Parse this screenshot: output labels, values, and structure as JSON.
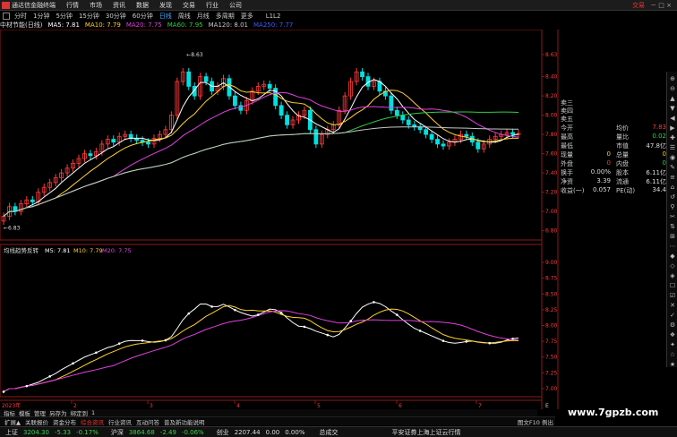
{
  "titlebar": {
    "app_name": "通达信金融终端",
    "menus": [
      "行情",
      "市场",
      "资讯",
      "数据",
      "发现",
      "交易",
      "行业",
      "公司"
    ],
    "trade": "交易",
    "win_controls": "－ □ ×"
  },
  "periods": {
    "items": [
      "分时",
      "1分钟",
      "5分钟",
      "15分钟",
      "30分钟",
      "60分钟",
      "日线",
      "周线",
      "月线",
      "多周期",
      "更多"
    ],
    "active_index": 6,
    "extra": "L1L2"
  },
  "main_legend": {
    "name": "中材节能(日线)",
    "items": [
      {
        "text": "MA5: 7.81",
        "color": "#ffffff"
      },
      {
        "text": "MA10: 7.79",
        "color": "#ffd02b"
      },
      {
        "text": "MA20: 7.75",
        "color": "#e040e0"
      },
      {
        "text": "MA60: 7.95",
        "color": "#30d040"
      },
      {
        "text": "MA120: 8.01",
        "color": "#c8c8c8"
      },
      {
        "text": "MA250: 7.77",
        "color": "#3c5cff"
      }
    ]
  },
  "price_axis": {
    "labels": [
      "8.63",
      "8.40",
      "8.20",
      "8.00",
      "7.80",
      "7.60",
      "7.40",
      "7.20",
      "7.00",
      "6.80"
    ],
    "ticks": [
      8.63,
      8.4,
      8.2,
      8.0,
      7.8,
      7.6,
      7.4,
      7.2,
      7.0,
      6.8
    ],
    "high_label": "8.63",
    "low_label": "6.83"
  },
  "sub_legend": {
    "name": "均线趋势反转",
    "items": [
      {
        "text": "M5: 7.81",
        "color": "#ffffff"
      },
      {
        "text": "M10: 7.79",
        "color": "#ffd02b"
      },
      {
        "text": "M20: 7.75",
        "color": "#e040e0"
      }
    ]
  },
  "sub_axis": {
    "labels": [
      "9.00",
      "8.75",
      "8.50",
      "8.25",
      "8.00",
      "7.75",
      "7.50",
      "7.25",
      "7.00"
    ],
    "ticks": [
      9.0,
      8.75,
      8.5,
      8.25,
      8.0,
      7.75,
      7.5,
      7.25,
      7.0
    ]
  },
  "x_axis": {
    "labels": [
      "2023年",
      "2",
      "3",
      "4",
      "5",
      "6",
      "7"
    ],
    "corner": "E"
  },
  "right_panel": {
    "order_book": [
      "卖三",
      "卖四",
      "卖五"
    ],
    "rows": [
      {
        "l1": "今开",
        "v1": "",
        "l2": "均价",
        "v2": "7.83",
        "c1": "#ddd",
        "c2": "#ff3b3b"
      },
      {
        "l1": "最高",
        "v1": "",
        "l2": "量比",
        "v2": "0.02",
        "c1": "#ff3b3b",
        "c2": "#3bd44b"
      },
      {
        "l1": "最低",
        "v1": "",
        "l2": "市值",
        "v2": "47.8亿",
        "c1": "#3bd44b",
        "c2": "#ddd"
      },
      {
        "l1": "现量",
        "v1": "0",
        "l2": "总量",
        "v2": "0",
        "c1": "#ffd02b",
        "c2": "#ffd02b"
      },
      {
        "l1": "外盘",
        "v1": "0",
        "l2": "内盘",
        "v2": "0",
        "c1": "#ff3b3b",
        "c2": "#3bd44b"
      },
      {
        "l1": "换手",
        "v1": "0.00%",
        "l2": "股本",
        "v2": "6.11亿",
        "c1": "#ddd",
        "c2": "#ddd"
      },
      {
        "l1": "净资",
        "v1": "3.39",
        "l2": "流通",
        "v2": "6.11亿",
        "c1": "#ddd",
        "c2": "#ddd"
      },
      {
        "l1": "收益(一)",
        "v1": "0.057",
        "l2": "PE(动)",
        "v2": "34.4",
        "c1": "#ddd",
        "c2": "#ddd"
      }
    ]
  },
  "right_tools": [
    "⊕",
    "⊖",
    "▲",
    "▼",
    "◀",
    "▶",
    "✚",
    "☰",
    "◉",
    "✎",
    "≡",
    "⌂",
    "↺",
    "⚲",
    "✂",
    "⇅",
    "⊞",
    "⋯",
    "◆",
    "◇",
    "◈",
    "☐",
    "☑",
    "✕",
    "✓",
    "⚙",
    "❖",
    "✦",
    "☆",
    "★"
  ],
  "tabs1": [
    "指标",
    "模板",
    "管理",
    "另存为",
    "绑定到",
    "1"
  ],
  "tabs2": [
    {
      "text": "扩展▲",
      "hl": false
    },
    {
      "text": "关联报价",
      "hl": false
    },
    {
      "text": "资金分布",
      "hl": false
    },
    {
      "text": "综合资讯",
      "hl": true
    },
    {
      "text": "行业资讯",
      "hl": false
    },
    {
      "text": "互动问答",
      "hl": false
    },
    {
      "text": "普及新功能说明",
      "hl": false
    }
  ],
  "tabs2_right": "图文F10 例出",
  "status": {
    "sh_name": "上证",
    "sh_val": "3204.30",
    "sh_chg": "-5.33",
    "sh_pct": "-0.17%",
    "hs_name": "沪深",
    "hs_val": "3864.68",
    "hs_chg": "-2.49",
    "hs_pct": "-0.06%",
    "cy_name": "创业",
    "cy_val": "2207.44",
    "cy_chg": "0.00",
    "cy_pct": "0.00%",
    "trade_label": "总成交",
    "broker": "平安证券上海上证云行情"
  },
  "watermark": "www.7gpzb.com",
  "colors": {
    "up": "#ff3b3b",
    "down": "#00e0e0",
    "ma5": "#ffffff",
    "ma10": "#ffd02b",
    "ma20": "#e040e0",
    "ma60": "#30d040",
    "ma120": "#c8c8c8",
    "ma250": "#3c5cff",
    "grid": "#8b1a1a"
  }
}
